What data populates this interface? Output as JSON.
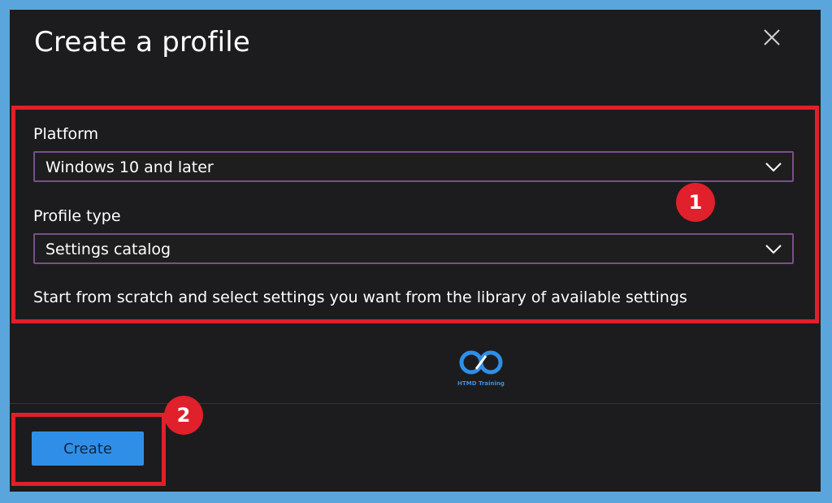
{
  "dialog": {
    "title": "Create a profile",
    "close_icon": "close-icon"
  },
  "form": {
    "platform": {
      "label": "Platform",
      "value": "Windows 10 and later"
    },
    "profile_type": {
      "label": "Profile type",
      "value": "Settings catalog"
    },
    "description": "Start from scratch and select settings you want from the library of available settings"
  },
  "footer": {
    "create_label": "Create"
  },
  "annotations": {
    "badge_1": "1",
    "badge_2": "2",
    "highlight_color": "#e0202a"
  },
  "watermark": {
    "text": "HTMD Training"
  },
  "colors": {
    "panel_bg": "#1c1c1e",
    "frame_bg": "#5aa6dc",
    "accent": "#2f8fe8",
    "select_border": "#7a4e8d"
  }
}
